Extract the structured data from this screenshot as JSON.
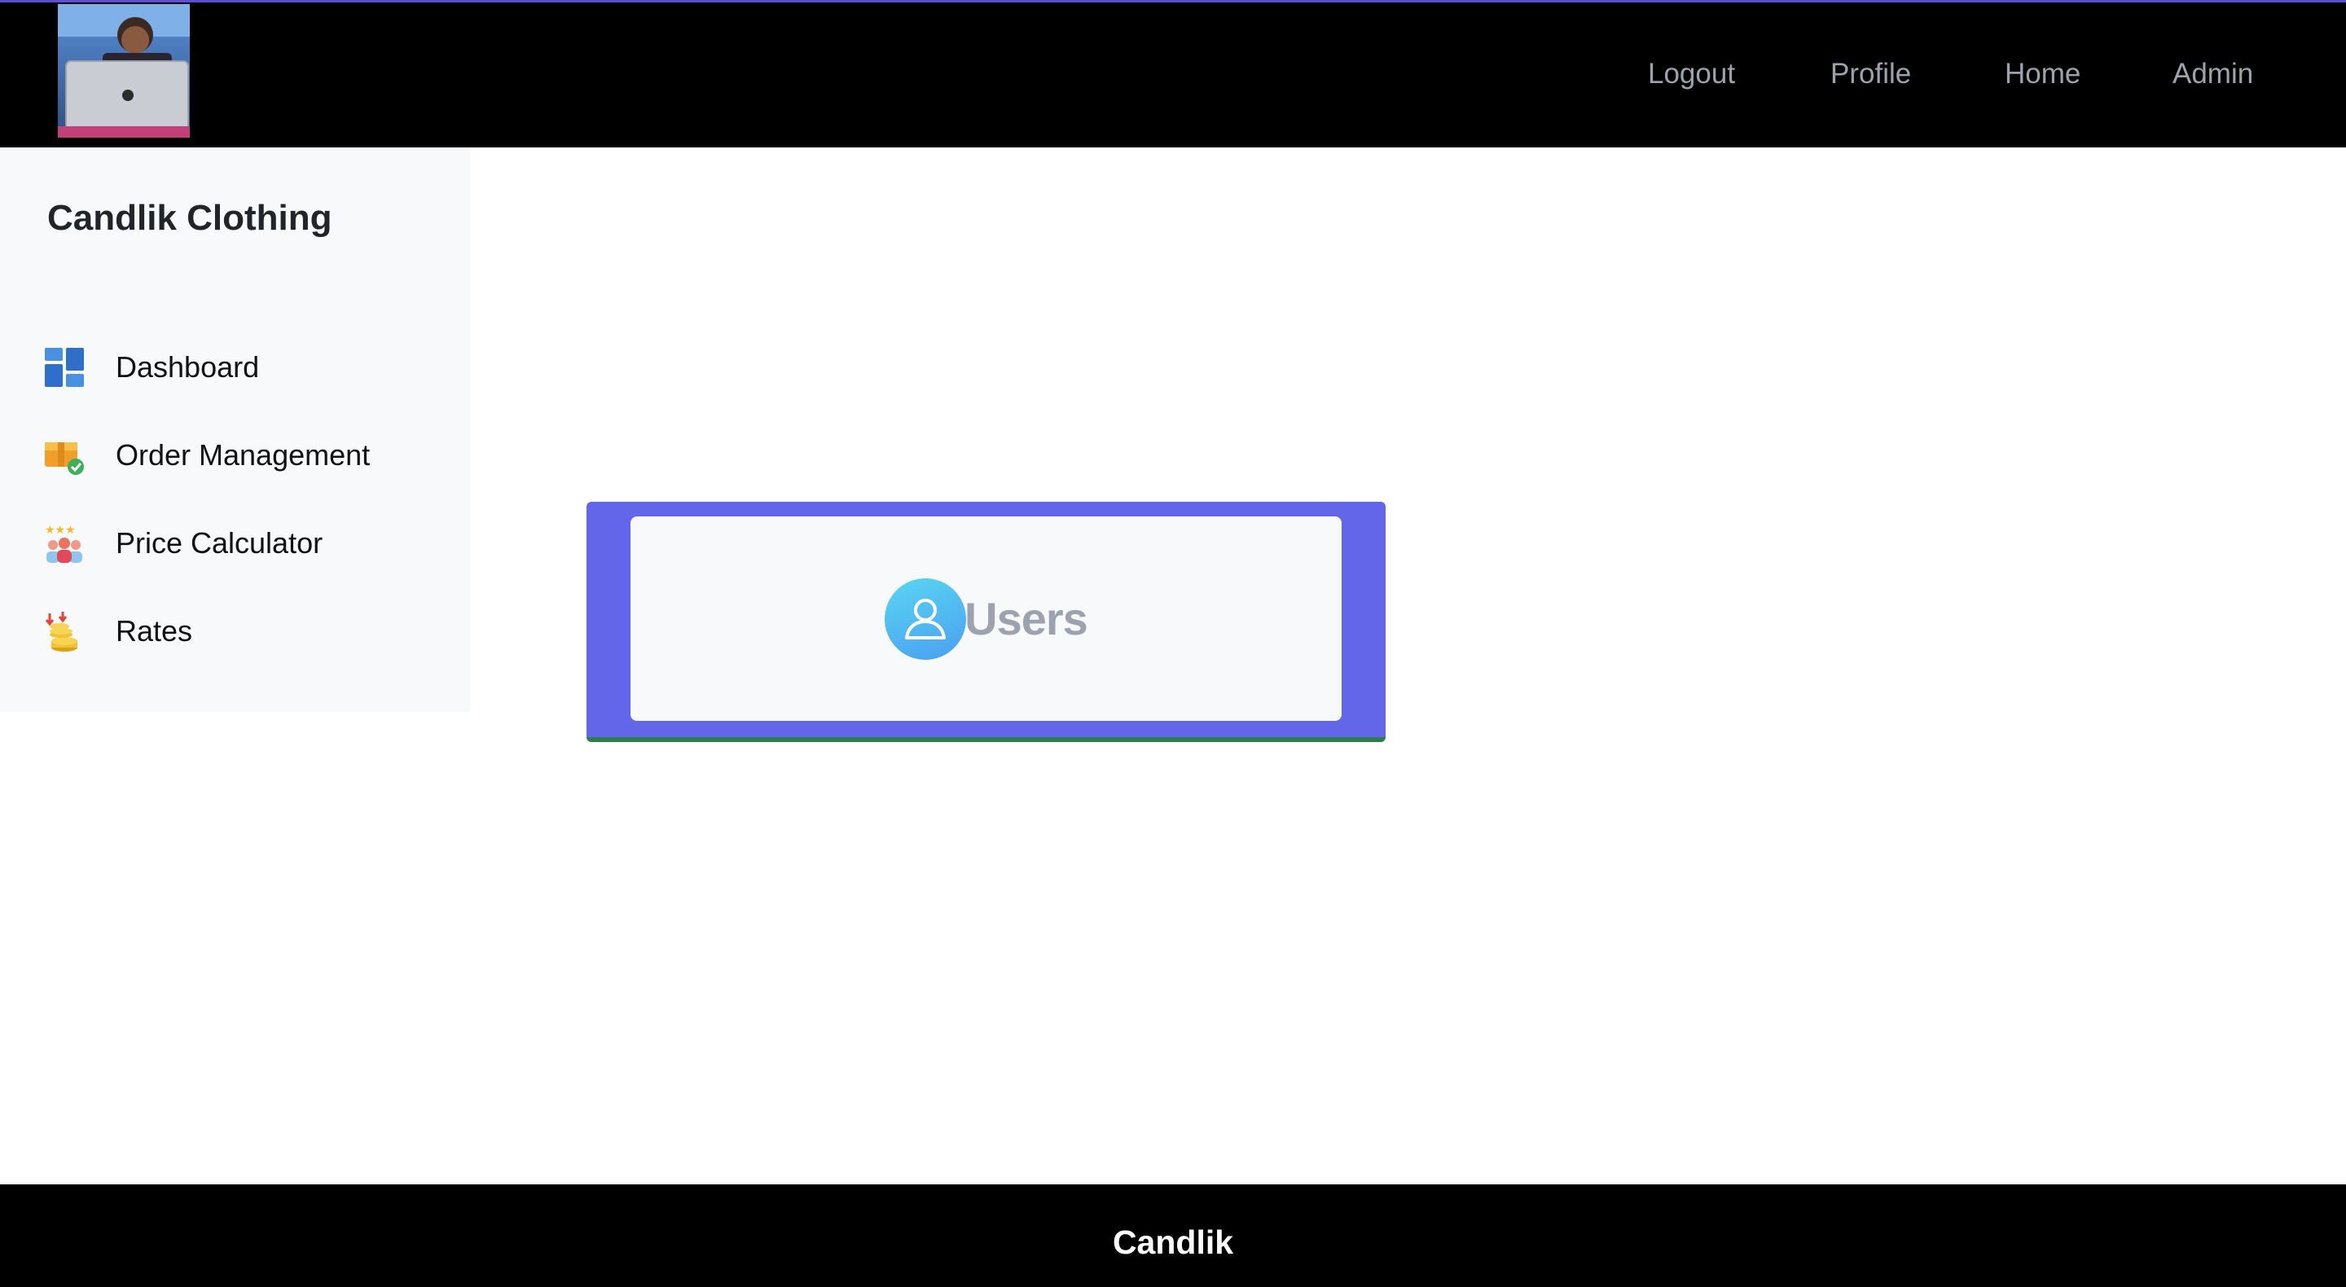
{
  "header": {
    "nav": [
      {
        "label": "Logout"
      },
      {
        "label": "Profile"
      },
      {
        "label": "Home"
      },
      {
        "label": "Admin"
      }
    ],
    "avatar_icon": "user-photo"
  },
  "sidebar": {
    "brand": "Candlik Clothing",
    "items": [
      {
        "label": "Dashboard",
        "icon": "dashboard-grid-icon"
      },
      {
        "label": "Order Management",
        "icon": "package-check-icon"
      },
      {
        "label": "Price Calculator",
        "icon": "people-rating-icon"
      },
      {
        "label": "Rates",
        "icon": "coins-icon"
      }
    ]
  },
  "main": {
    "users_card": {
      "label": "Users",
      "icon": "user-icon"
    }
  },
  "footer": {
    "text": "Candlik"
  },
  "colors": {
    "topbar": "#000000",
    "nav_text": "#9ca3af",
    "sidebar_bg": "#f8f9fa",
    "card_accent": "#6366e8",
    "card_border_bottom": "#2e7d4f",
    "footer": "#000000"
  }
}
